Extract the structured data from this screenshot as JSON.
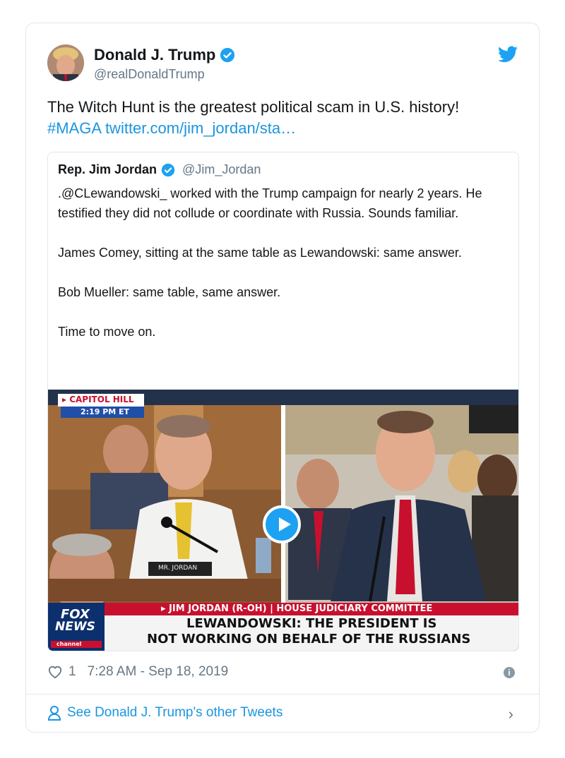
{
  "author": {
    "name": "Donald J. Trump",
    "handle": "@realDonaldTrump"
  },
  "tweet": {
    "text_plain": "The Witch Hunt is the greatest political scam in U.S. history!",
    "hashtag": "#MAGA",
    "link": "twitter.com/jim_jordan/sta…"
  },
  "quote": {
    "name": "Rep. Jim Jordan",
    "handle": "@Jim_Jordan",
    "paragraphs": [
      ".@CLewandowski_ worked with the Trump campaign for nearly 2 years. He testified they did not collude or coordinate with Russia. Sounds familiar.",
      "James Comey, sitting at the same table as Lewandowski: same answer.",
      "Bob Mueller: same table, same answer.",
      "Time to move on."
    ]
  },
  "media": {
    "location_tag": "▸ CAPITOL HILL",
    "time_tag": "2:19 PM ET",
    "nameplate": "MR. JORDAN",
    "fox_line1": "FOX",
    "fox_line2": "NEWS",
    "fox_line3": "channel",
    "lower_third_top": "▸ JIM JORDAN (R-OH) | HOUSE JUDICIARY COMMITTEE",
    "headline_line1": "LEWANDOWSKI: THE PRESIDENT IS",
    "headline_line2": "NOT WORKING ON BEHALF OF THE RUSSIANS"
  },
  "footer": {
    "likes": "1",
    "timestamp": "7:28 AM - Sep 18, 2019",
    "see_more": "See Donald J. Trump's other Tweets"
  },
  "colors": {
    "accent": "#1da1f2",
    "link": "#1b95e0",
    "muted": "#657786",
    "fox_red": "#c8102e"
  }
}
